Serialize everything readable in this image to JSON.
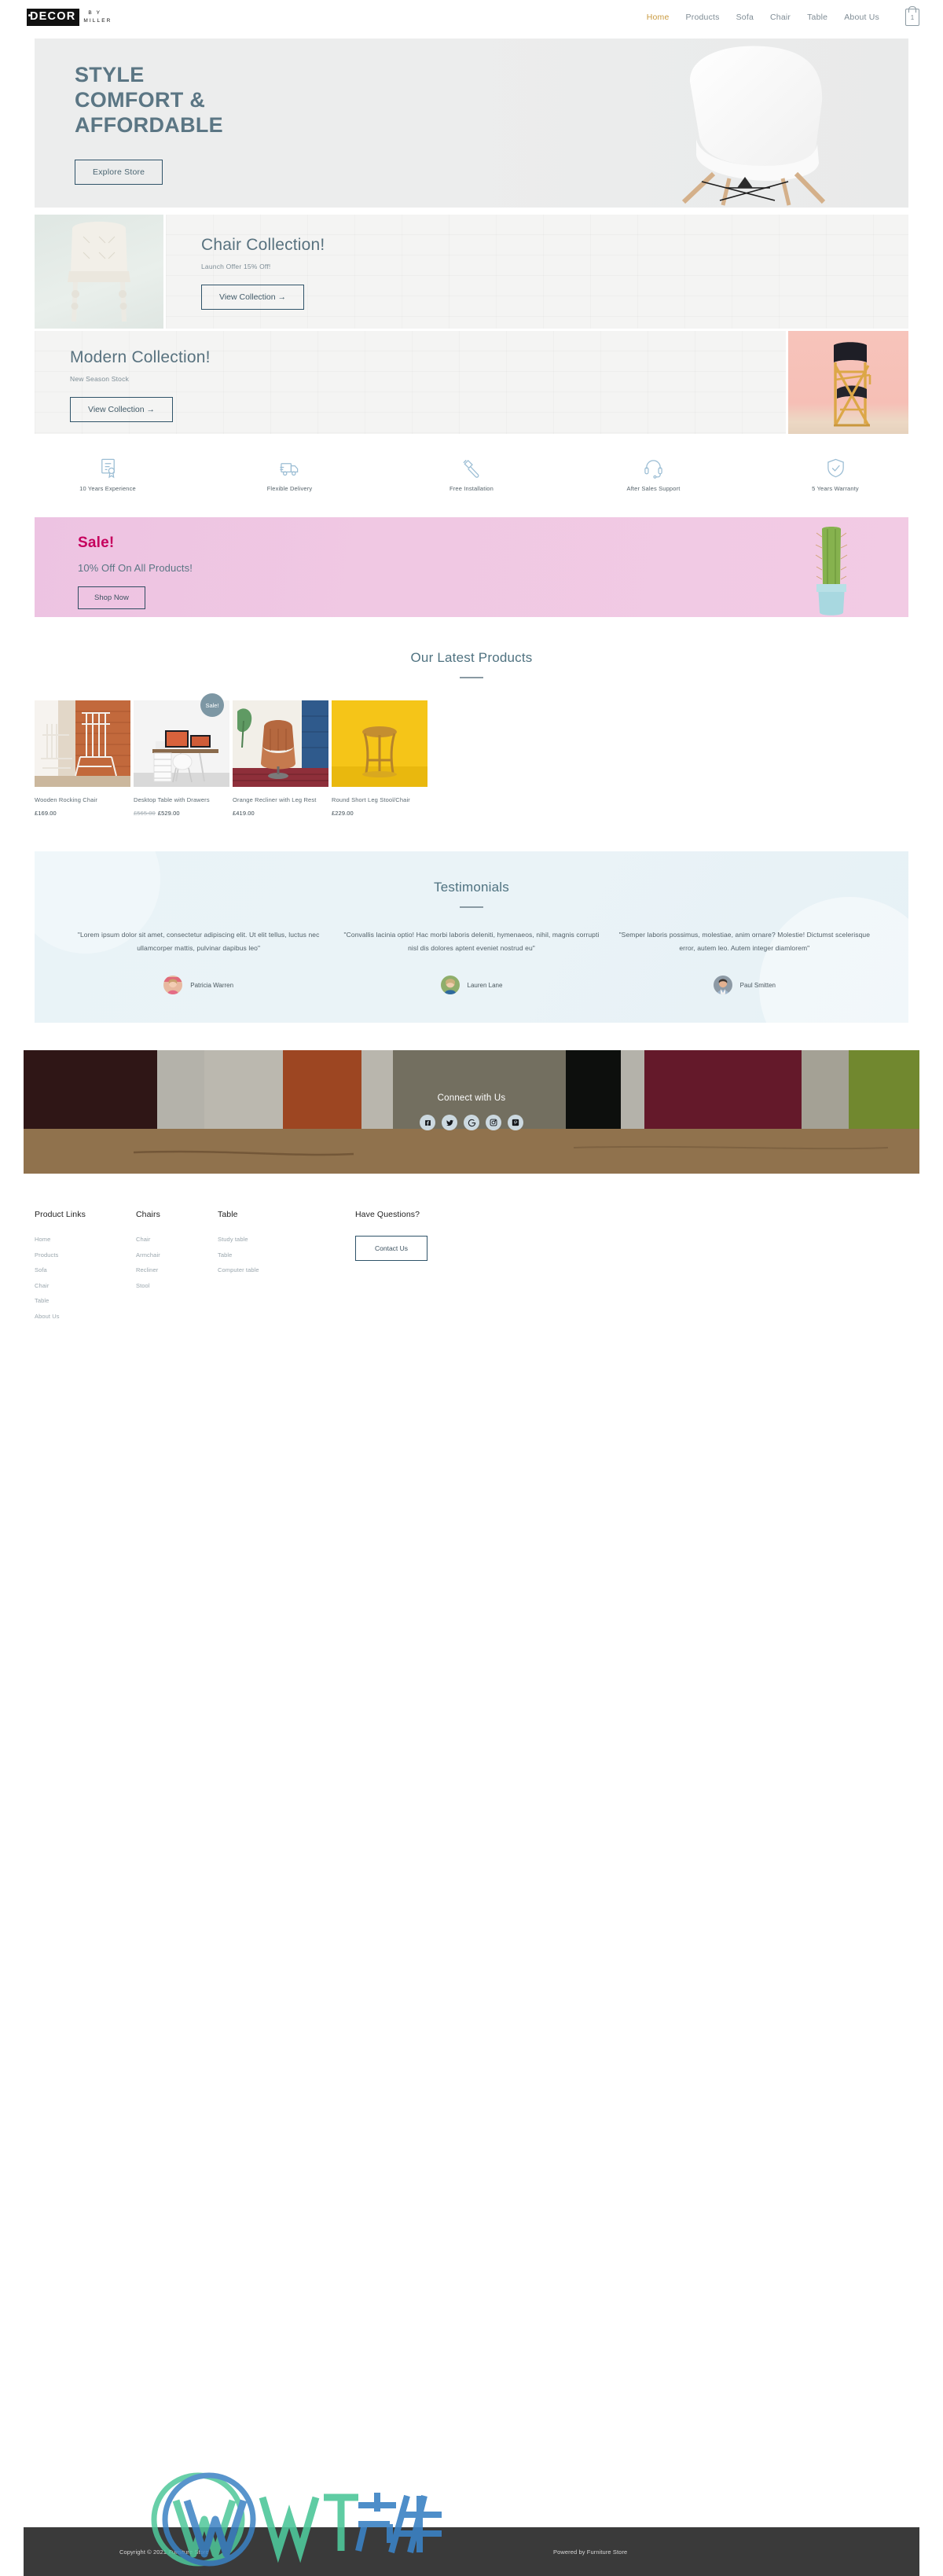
{
  "header": {
    "brand": {
      "mark": "DECOR",
      "by": "B Y",
      "miller": "MILLER"
    },
    "nav": [
      {
        "label": "Home",
        "active": true
      },
      {
        "label": "Products",
        "active": false
      },
      {
        "label": "Sofa",
        "active": false
      },
      {
        "label": "Chair",
        "active": false
      },
      {
        "label": "Table",
        "active": false
      },
      {
        "label": "About Us",
        "active": false
      }
    ],
    "cart_count": "1"
  },
  "hero": {
    "line1": "STYLE",
    "line2": "COMFORT &",
    "line3": "AFFORDABLE",
    "cta": "Explore Store"
  },
  "collections": [
    {
      "title": "Chair Collection!",
      "subtitle": "Launch Offer 15% Off!",
      "cta": "View Collection →"
    },
    {
      "title": "Modern Collection!",
      "subtitle": "New Season Stock",
      "cta": "View Collection →"
    }
  ],
  "features": [
    {
      "icon": "certificate-icon",
      "label": "10 Years Experience"
    },
    {
      "icon": "truck-icon",
      "label": "Flexible Delivery"
    },
    {
      "icon": "hammer-icon",
      "label": "Free Installation"
    },
    {
      "icon": "headset-icon",
      "label": "After Sales Support"
    },
    {
      "icon": "shield-check-icon",
      "label": "5 Years Warranty"
    }
  ],
  "sale": {
    "title": "Sale!",
    "subtitle": "10% Off On All Products!",
    "cta": "Shop Now"
  },
  "latest_products": {
    "section_title": "Our Latest Products",
    "items": [
      {
        "name": "Wooden Rocking Chair",
        "price": "£169.00",
        "old_price": "",
        "badge": ""
      },
      {
        "name": "Desktop Table with Drawers",
        "price": "£529.00",
        "old_price": "£565.00",
        "badge": "Sale!"
      },
      {
        "name": "Orange Recliner with Leg Rest",
        "price": "£419.00",
        "old_price": "",
        "badge": ""
      },
      {
        "name": "Round Short Leg Stool/Chair",
        "price": "£229.00",
        "old_price": "",
        "badge": ""
      }
    ]
  },
  "testimonials": {
    "section_title": "Testimonials",
    "items": [
      {
        "quote": "\"Lorem ipsum dolor sit amet, consectetur adipiscing elit. Ut elit tellus, luctus nec ullamcorper mattis, pulvinar dapibus leo\"",
        "author": "Patricia Warren"
      },
      {
        "quote": "\"Convallis lacinia optio! Hac morbi laboris deleniti, hymenaeos, nihil, magnis corrupti nisl dis dolores aptent eveniet nostrud eu\"",
        "author": "Lauren Lane"
      },
      {
        "quote": "\"Semper laboris possimus, molestiae, anim ornare? Molestie! Dictumst scelerisque error, autem leo. Autem integer diamlorem\"",
        "author": "Paul Smitten"
      }
    ]
  },
  "connect": {
    "title": "Connect with Us",
    "socials": [
      {
        "icon": "facebook-icon",
        "label": "Facebook"
      },
      {
        "icon": "twitter-icon",
        "label": "Twitter"
      },
      {
        "icon": "google-icon",
        "label": "Google"
      },
      {
        "icon": "instagram-icon",
        "label": "Instagram"
      },
      {
        "icon": "pinterest-icon",
        "label": "Pinterest"
      }
    ]
  },
  "footer": {
    "columns": [
      {
        "title": "Product Links",
        "links": [
          "Home",
          "Products",
          "Sofa",
          "Chair",
          "Table",
          "About Us"
        ]
      },
      {
        "title": "Chairs",
        "links": [
          "Chair",
          "Armchair",
          "Recliner",
          "Stool"
        ]
      },
      {
        "title": "Table",
        "links": [
          "Study table",
          "Table",
          "Computer table"
        ]
      }
    ],
    "questions_title": "Have Questions?",
    "contact_cta": "Contact Us",
    "copyright": "Copyright © 2021 Furniture Store",
    "powered_by": "Powered by Furniture Store"
  },
  "colors": {
    "accent_gold": "#c99a3f",
    "heading_blue": "#5b7684",
    "sale_pink": "#c6005d",
    "border_navy": "#2f5369"
  }
}
